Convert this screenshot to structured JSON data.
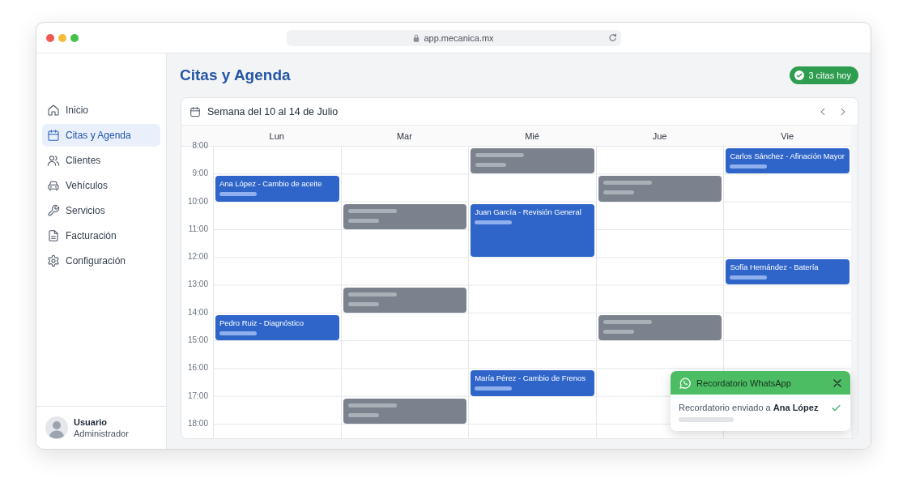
{
  "browser": {
    "url": "app.mecanica.mx"
  },
  "sidebar": {
    "items": [
      {
        "label": "Inicio",
        "selected": false
      },
      {
        "label": "Citas y Agenda",
        "selected": true
      },
      {
        "label": "Clientes",
        "selected": false
      },
      {
        "label": "Vehículos",
        "selected": false
      },
      {
        "label": "Servicios",
        "selected": false
      },
      {
        "label": "Facturación",
        "selected": false
      },
      {
        "label": "Configuración",
        "selected": false
      }
    ],
    "user": {
      "name": "Usuario",
      "role": "Administrador"
    }
  },
  "header": {
    "title": "Citas y Agenda",
    "badge": "3 citas hoy"
  },
  "calendar": {
    "week_label": "Semana del 10 al 14 de Julio",
    "hours": [
      "8:00",
      "9:00",
      "10:00",
      "11:00",
      "12:00",
      "13:00",
      "14:00",
      "15:00",
      "16:00",
      "17:00",
      "18:00"
    ],
    "days": [
      {
        "label": "Lun",
        "slots": [
          {
            "kind": "free"
          },
          {
            "kind": "appointment",
            "title": "Ana López - Cambio de aceite"
          },
          {
            "kind": "free"
          },
          {
            "kind": "free"
          },
          {
            "kind": "free"
          },
          {
            "kind": "free"
          },
          {
            "kind": "appointment",
            "title": "Pedro Ruiz - Diagnóstico"
          },
          {
            "kind": "free"
          },
          {
            "kind": "free"
          },
          {
            "kind": "free"
          },
          {
            "kind": "free"
          }
        ]
      },
      {
        "label": "Mar",
        "slots": [
          {
            "kind": "free"
          },
          {
            "kind": "free"
          },
          {
            "kind": "placeholder"
          },
          {
            "kind": "free"
          },
          {
            "kind": "free"
          },
          {
            "kind": "placeholder"
          },
          {
            "kind": "free"
          },
          {
            "kind": "free"
          },
          {
            "kind": "free"
          },
          {
            "kind": "placeholder"
          },
          {
            "kind": "free"
          }
        ]
      },
      {
        "label": "Mié",
        "slots": [
          {
            "kind": "placeholder"
          },
          {
            "kind": "free"
          },
          {
            "kind": "appointment",
            "title": "Juan García - Revisión General"
          },
          {
            "kind": "continuation"
          },
          {
            "kind": "free"
          },
          {
            "kind": "free"
          },
          {
            "kind": "free"
          },
          {
            "kind": "free"
          },
          {
            "kind": "appointment",
            "title": "María Pérez - Cambio de Frenos"
          },
          {
            "kind": "free"
          },
          {
            "kind": "free"
          }
        ]
      },
      {
        "label": "Jue",
        "slots": [
          {
            "kind": "free"
          },
          {
            "kind": "placeholder"
          },
          {
            "kind": "free"
          },
          {
            "kind": "free"
          },
          {
            "kind": "free"
          },
          {
            "kind": "free"
          },
          {
            "kind": "placeholder"
          },
          {
            "kind": "free"
          },
          {
            "kind": "free"
          },
          {
            "kind": "free"
          },
          {
            "kind": "free"
          }
        ]
      },
      {
        "label": "Vie",
        "slots": [
          {
            "kind": "appointment",
            "title": "Carlos Sánchez - Afinación Mayor"
          },
          {
            "kind": "free"
          },
          {
            "kind": "free"
          },
          {
            "kind": "free"
          },
          {
            "kind": "appointment",
            "title": "Sofía Hernández - Batería"
          },
          {
            "kind": "free"
          },
          {
            "kind": "free"
          },
          {
            "kind": "free"
          },
          {
            "kind": "free"
          },
          {
            "kind": "free"
          },
          {
            "kind": "free"
          }
        ]
      }
    ]
  },
  "notification": {
    "title": "Recordatorio WhatsApp",
    "message": "Recordatorio enviado a **Ana López**"
  }
}
